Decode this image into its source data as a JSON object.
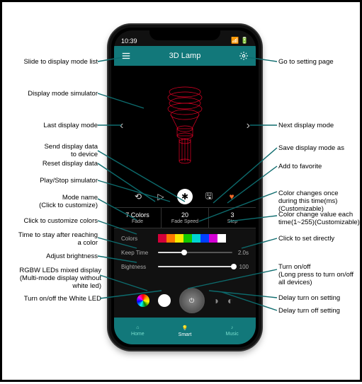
{
  "statusbar": {
    "time": "10:39"
  },
  "topbar": {
    "title": "3D Lamp"
  },
  "ctrl": {
    "reset": "⟲",
    "play": "▷",
    "bt": "✱",
    "save": "🖫",
    "fav": "♥"
  },
  "mode": {
    "colors_val": "7 Colors",
    "colors_lbl": "Fade",
    "speed_val": "20",
    "speed_lbl": "Fade Speed",
    "step_val": "3",
    "step_lbl": "Step"
  },
  "params": {
    "colors_lbl": "Colors",
    "keep_lbl": "Keep Time",
    "keep_val": "2.0s",
    "bright_lbl": "Bightness",
    "bright_val": "100"
  },
  "swatches": [
    "#d4003a",
    "#ff7a00",
    "#f8e800",
    "#13c800",
    "#00d4d4",
    "#0040ff",
    "#d400d4",
    "#ffffff"
  ],
  "nav": {
    "home": "Home",
    "smart": "Smart",
    "music": "Music"
  },
  "ann": {
    "l1": "Slide to display mode list",
    "l2": "Display mode simulator",
    "l3": "Last display mode",
    "l4": "Send display data\nto device",
    "l5": "Reset display data",
    "l6": "Play/Stop simulator",
    "l7": "Mode name",
    "l7s": "(Click to customize)",
    "l8": "Click to customize colors",
    "l9": "Time to stay after reaching\na color",
    "l10": "Adjust brightness",
    "l11": "RGBW LEDs mixed display",
    "l11s": "(Multi-mode display without\nwhite led)",
    "l12": "Turn on/off the White LED",
    "r1": "Go to setting page",
    "r2": "Next display mode",
    "r3": "Save display mode as",
    "r4": "Add to favorite",
    "r5": "Color changes once\nduring this time(ms)",
    "r5s": "(Customizable)",
    "r6": "Color change value each\ntime",
    "r6s": "(1~255)(Customizable)",
    "r7": "Click to set directly",
    "r8": "Turn on/off",
    "r8s": "(Long press to turn on/off\nall devices)",
    "r9": "Delay turn on setting",
    "r10": "Delay turn off setting"
  }
}
